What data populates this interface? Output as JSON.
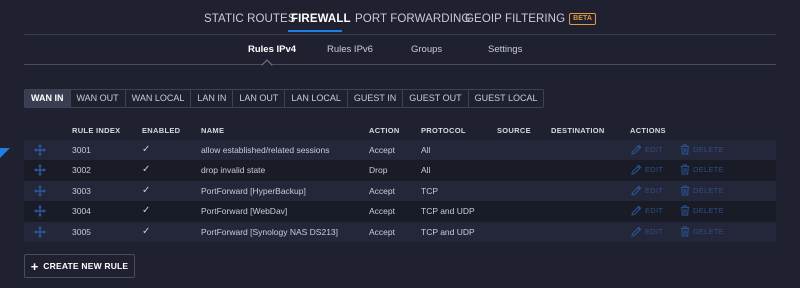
{
  "topnav": {
    "tabs": [
      {
        "label": "STATIC ROUTES"
      },
      {
        "label": "FIREWALL"
      },
      {
        "label": "PORT FORWARDING"
      },
      {
        "label": "GEOIP FILTERING",
        "badge": "BETA"
      }
    ],
    "active": "FIREWALL"
  },
  "subnav": {
    "tabs": [
      {
        "label": "Rules IPv4"
      },
      {
        "label": "Rules IPv6"
      },
      {
        "label": "Groups"
      },
      {
        "label": "Settings"
      }
    ],
    "active": "Rules IPv4"
  },
  "chains": {
    "items": [
      "WAN IN",
      "WAN OUT",
      "WAN LOCAL",
      "LAN IN",
      "LAN OUT",
      "LAN LOCAL",
      "GUEST IN",
      "GUEST OUT",
      "GUEST LOCAL"
    ],
    "active": "WAN IN"
  },
  "table": {
    "columns": {
      "rule_index": "RULE INDEX",
      "enabled": "ENABLED",
      "name": "NAME",
      "action": "ACTION",
      "protocol": "PROTOCOL",
      "source": "SOURCE",
      "destination": "DESTINATION",
      "actions": "ACTIONS"
    },
    "rows": [
      {
        "index": "3001",
        "enabled": "✓",
        "name": "allow established/related sessions",
        "action": "Accept",
        "protocol": "All",
        "edit": "EDIT",
        "delete": "DELETE"
      },
      {
        "index": "3002",
        "enabled": "✓",
        "name": "drop invalid state",
        "action": "Drop",
        "protocol": "All",
        "edit": "EDIT",
        "delete": "DELETE"
      },
      {
        "index": "3003",
        "enabled": "✓",
        "name": "PortForward [HyperBackup]",
        "action": "Accept",
        "protocol": "TCP",
        "edit": "EDIT",
        "delete": "DELETE"
      },
      {
        "index": "3004",
        "enabled": "✓",
        "name": "PortForward [WebDav]",
        "action": "Accept",
        "protocol": "TCP and UDP",
        "edit": "EDIT",
        "delete": "DELETE"
      },
      {
        "index": "3005",
        "enabled": "✓",
        "name": "PortForward [Synology NAS DS213]",
        "action": "Accept",
        "protocol": "TCP and UDP",
        "edit": "EDIT",
        "delete": "DELETE"
      }
    ]
  },
  "create_button": {
    "label": "CREATE NEW RULE",
    "icon": "plus-icon"
  },
  "colors": {
    "background": "#1f2130",
    "accent": "#1e7ee6",
    "beta_badge": "#e09b3d",
    "action_link_disabled": "#2b4f86"
  }
}
